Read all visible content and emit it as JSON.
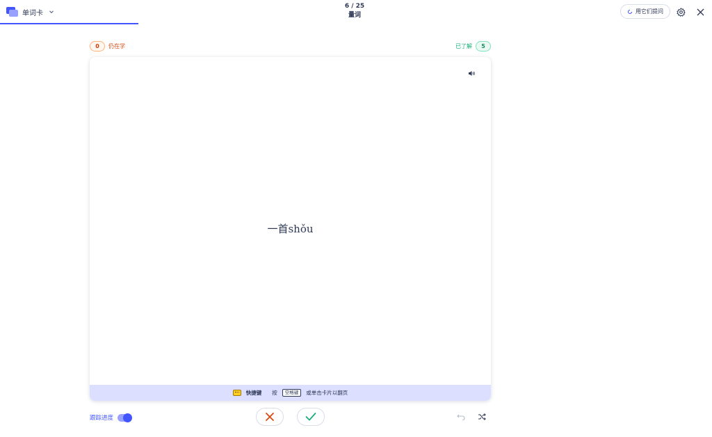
{
  "header": {
    "mode_label": "单词卡",
    "progress": "6 / 25",
    "set_title": "量词",
    "options_label": "用它们提问",
    "icons": {
      "mode": "flashcards-icon",
      "chevron": "chevron-down-icon",
      "options": "loading-circle-icon",
      "settings": "gear-icon",
      "close": "close-icon"
    }
  },
  "counters": {
    "still_learning": {
      "count": "0",
      "label": "仍在学"
    },
    "know": {
      "count": "5",
      "label": "已了解"
    }
  },
  "card": {
    "term": "一首shǒu",
    "audio_icon": "speaker-icon",
    "footer": {
      "title": "快捷键",
      "press": "按",
      "key": "空格键",
      "hint": "或单击卡片以翻页",
      "icon": "keyboard-icon"
    }
  },
  "controls": {
    "track_progress_label": "跟踪进度",
    "track_progress_on": true,
    "icons": {
      "dont_know": "x-icon",
      "know": "check-icon",
      "undo": "undo-icon",
      "shuffle": "shuffle-icon"
    }
  },
  "colors": {
    "accent": "#4255ff",
    "still_learning": "#d9480f",
    "know": "#18ae79",
    "footer_bg": "#dcdfff"
  }
}
